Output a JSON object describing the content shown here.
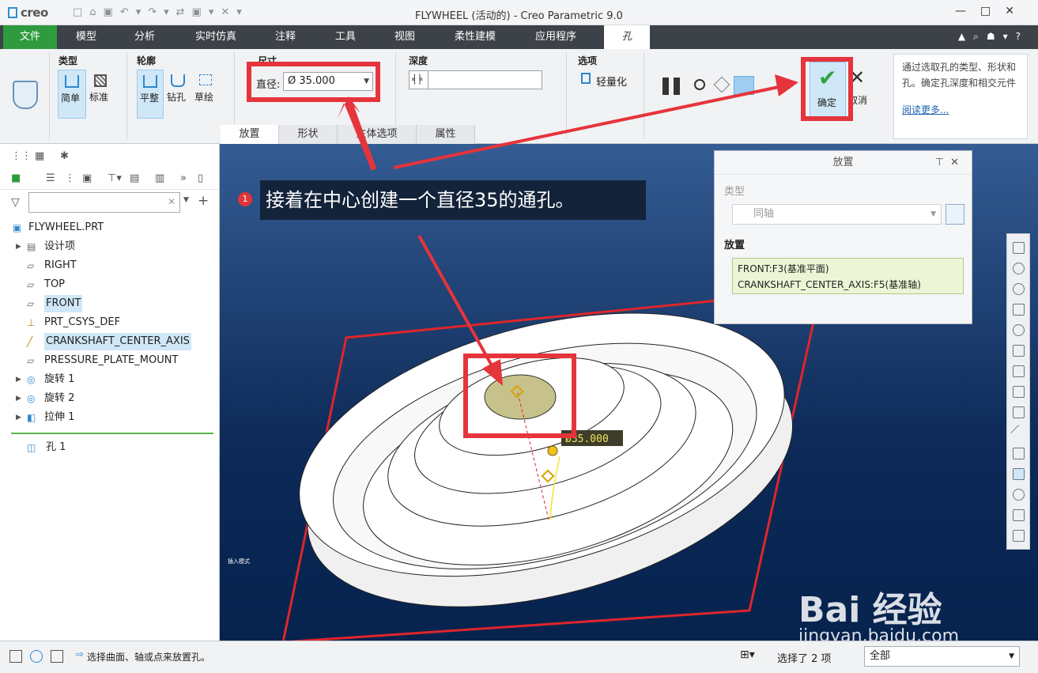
{
  "app": {
    "logo": "creo",
    "window_title": "FLYWHEEL (活动的) - Creo Parametric 9.0"
  },
  "tabs": [
    {
      "label": "文件"
    },
    {
      "label": "模型"
    },
    {
      "label": "分析"
    },
    {
      "label": "实时仿真"
    },
    {
      "label": "注释"
    },
    {
      "label": "工具"
    },
    {
      "label": "视图"
    },
    {
      "label": "柔性建模"
    },
    {
      "label": "应用程序"
    },
    {
      "label": "孔"
    }
  ],
  "ribbon": {
    "type_group": {
      "label": "类型",
      "simple": "简单",
      "standard": "标准"
    },
    "profile_group": {
      "label": "轮廓",
      "flat": "平整",
      "drill": "钻孔",
      "sketch": "草绘"
    },
    "dimension_group": {
      "label": "尺寸",
      "diameter_label": "直径:",
      "diameter_value": "Ø 35.000"
    },
    "depth_group": {
      "label": "深度"
    },
    "options_group": {
      "label": "选项",
      "lightweight": "轻量化"
    },
    "ok_label": "确定",
    "cancel_label": "取消",
    "help_text": "通过选取孔的类型、形状和孔。确定孔深度和相交元件",
    "help_link": "阅读更多..."
  },
  "subtabs": [
    {
      "label": "放置"
    },
    {
      "label": "形状"
    },
    {
      "label": "主体选项"
    },
    {
      "label": "属性"
    }
  ],
  "tree": {
    "root": "FLYWHEEL.PRT",
    "items": [
      {
        "label": "设计项"
      },
      {
        "label": "RIGHT"
      },
      {
        "label": "TOP"
      },
      {
        "label": "FRONT"
      },
      {
        "label": "PRT_CSYS_DEF"
      },
      {
        "label": "CRANKSHAFT_CENTER_AXIS"
      },
      {
        "label": "PRESSURE_PLATE_MOUNT"
      },
      {
        "label": "旋转 1"
      },
      {
        "label": "旋转 2"
      },
      {
        "label": "拉伸 1"
      },
      {
        "label": "孔 1"
      }
    ]
  },
  "viewport": {
    "callout_number": "1",
    "callout_text": "接着在中心创建一个直径35的通孔。",
    "dim_label": "Ø35.000",
    "mode_text": "插入模式"
  },
  "placement_dialog": {
    "title": "放置",
    "type_label": "类型",
    "type_value": "同轴",
    "placement_label": "放置",
    "refs": [
      "FRONT:F3(基准平面)",
      "CRANKSHAFT_CENTER_AXIS:F5(基准轴)"
    ]
  },
  "status": {
    "message": "选择曲面、轴或点来放置孔。",
    "selected": "选择了 2 项",
    "filter": "全部"
  },
  "watermark": {
    "line1": "Bai 经验",
    "line2": "jingyan.baidu.com"
  },
  "colors": {
    "accent_green": "#2e9b3f",
    "highlight_red": "#e5343b",
    "selection_blue": "#cfe7f7"
  }
}
